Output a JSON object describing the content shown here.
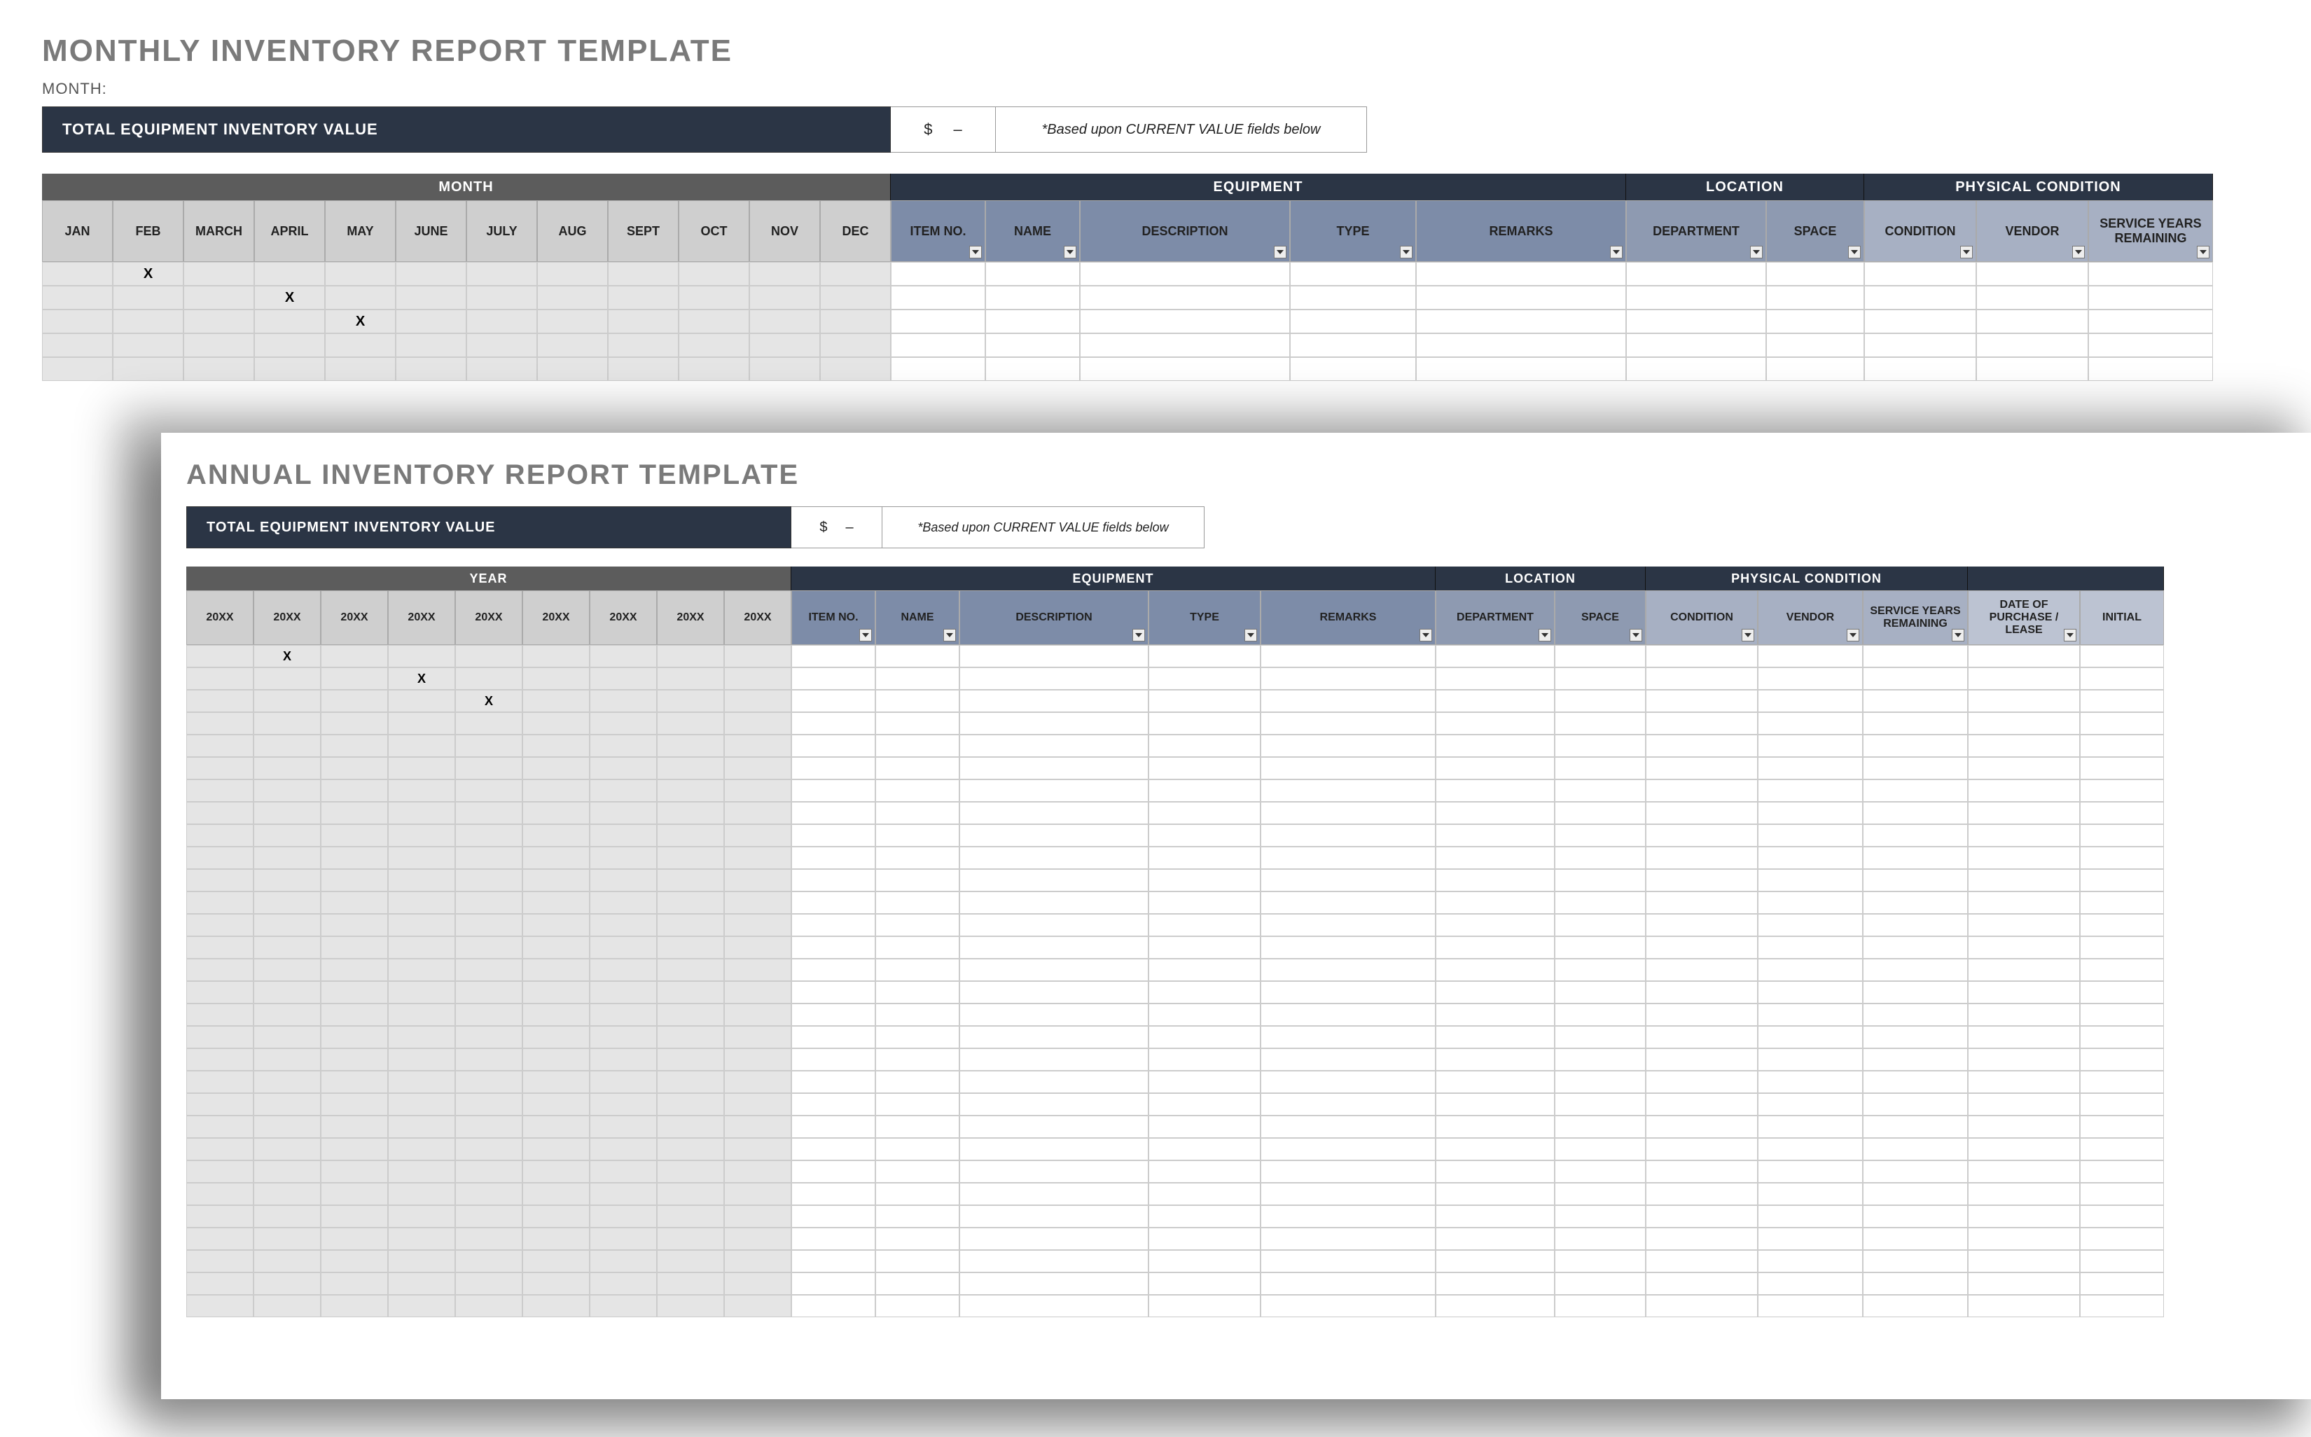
{
  "monthly": {
    "title": "MONTHLY INVENTORY REPORT TEMPLATE",
    "month_label": "MONTH:",
    "total_label": "TOTAL EQUIPMENT INVENTORY VALUE",
    "total_currency": "$",
    "total_amount": "–",
    "total_note": "*Based upon CURRENT VALUE fields below",
    "band_month": "MONTH",
    "band_equipment": "EQUIPMENT",
    "band_location": "LOCATION",
    "band_physical": "PHYSICAL CONDITION",
    "months": [
      "JAN",
      "FEB",
      "MARCH",
      "APRIL",
      "MAY",
      "JUNE",
      "JULY",
      "AUG",
      "SEPT",
      "OCT",
      "NOV",
      "DEC"
    ],
    "cols": {
      "item": "ITEM NO.",
      "name": "NAME",
      "desc": "DESCRIPTION",
      "type": "TYPE",
      "remarks": "REMARKS",
      "dept": "DEPARTMENT",
      "space": "SPACE",
      "cond": "CONDITION",
      "vendor": "VENDOR",
      "service": "SERVICE YEARS REMAINING"
    },
    "rows": [
      {
        "month_marks": [
          "",
          "X",
          "",
          "",
          "",
          "",
          "",
          "",
          "",
          "",
          "",
          ""
        ]
      },
      {
        "month_marks": [
          "",
          "",
          "",
          "X",
          "",
          "",
          "",
          "",
          "",
          "",
          "",
          ""
        ]
      },
      {
        "month_marks": [
          "",
          "",
          "",
          "",
          "X",
          "",
          "",
          "",
          "",
          "",
          "",
          ""
        ]
      },
      {
        "month_marks": [
          "",
          "",
          "",
          "",
          "",
          "",
          "",
          "",
          "",
          "",
          "",
          ""
        ]
      },
      {
        "month_marks": [
          "",
          "",
          "",
          "",
          "",
          "",
          "",
          "",
          "",
          "",
          "",
          ""
        ]
      }
    ]
  },
  "annual": {
    "title": "ANNUAL INVENTORY REPORT TEMPLATE",
    "total_label": "TOTAL EQUIPMENT INVENTORY VALUE",
    "total_currency": "$",
    "total_amount": "–",
    "total_note": "*Based upon CURRENT VALUE fields below",
    "band_year": "YEAR",
    "band_equipment": "EQUIPMENT",
    "band_location": "LOCATION",
    "band_physical": "PHYSICAL CONDITION",
    "years": [
      "20XX",
      "20XX",
      "20XX",
      "20XX",
      "20XX",
      "20XX",
      "20XX",
      "20XX",
      "20XX"
    ],
    "cols": {
      "item": "ITEM NO.",
      "name": "NAME",
      "desc": "DESCRIPTION",
      "type": "TYPE",
      "remarks": "REMARKS",
      "dept": "DEPARTMENT",
      "space": "SPACE",
      "cond": "CONDITION",
      "vendor": "VENDOR",
      "service": "SERVICE YEARS REMAINING",
      "date": "DATE OF PURCHASE / LEASE",
      "initial": "INITIAL"
    },
    "rows": [
      {
        "year_marks": [
          "",
          "X",
          "",
          "",
          "",
          "",
          "",
          "",
          ""
        ]
      },
      {
        "year_marks": [
          "",
          "",
          "",
          "X",
          "",
          "",
          "",
          "",
          ""
        ]
      },
      {
        "year_marks": [
          "",
          "",
          "",
          "",
          "X",
          "",
          "",
          "",
          ""
        ]
      },
      {
        "year_marks": [
          "",
          "",
          "",
          "",
          "",
          "",
          "",
          "",
          ""
        ]
      },
      {
        "year_marks": [
          "",
          "",
          "",
          "",
          "",
          "",
          "",
          "",
          ""
        ]
      },
      {
        "year_marks": [
          "",
          "",
          "",
          "",
          "",
          "",
          "",
          "",
          ""
        ]
      },
      {
        "year_marks": [
          "",
          "",
          "",
          "",
          "",
          "",
          "",
          "",
          ""
        ]
      },
      {
        "year_marks": [
          "",
          "",
          "",
          "",
          "",
          "",
          "",
          "",
          ""
        ]
      },
      {
        "year_marks": [
          "",
          "",
          "",
          "",
          "",
          "",
          "",
          "",
          ""
        ]
      },
      {
        "year_marks": [
          "",
          "",
          "",
          "",
          "",
          "",
          "",
          "",
          ""
        ]
      },
      {
        "year_marks": [
          "",
          "",
          "",
          "",
          "",
          "",
          "",
          "",
          ""
        ]
      },
      {
        "year_marks": [
          "",
          "",
          "",
          "",
          "",
          "",
          "",
          "",
          ""
        ]
      },
      {
        "year_marks": [
          "",
          "",
          "",
          "",
          "",
          "",
          "",
          "",
          ""
        ]
      },
      {
        "year_marks": [
          "",
          "",
          "",
          "",
          "",
          "",
          "",
          "",
          ""
        ]
      },
      {
        "year_marks": [
          "",
          "",
          "",
          "",
          "",
          "",
          "",
          "",
          ""
        ]
      },
      {
        "year_marks": [
          "",
          "",
          "",
          "",
          "",
          "",
          "",
          "",
          ""
        ]
      },
      {
        "year_marks": [
          "",
          "",
          "",
          "",
          "",
          "",
          "",
          "",
          ""
        ]
      },
      {
        "year_marks": [
          "",
          "",
          "",
          "",
          "",
          "",
          "",
          "",
          ""
        ]
      },
      {
        "year_marks": [
          "",
          "",
          "",
          "",
          "",
          "",
          "",
          "",
          ""
        ]
      },
      {
        "year_marks": [
          "",
          "",
          "",
          "",
          "",
          "",
          "",
          "",
          ""
        ]
      },
      {
        "year_marks": [
          "",
          "",
          "",
          "",
          "",
          "",
          "",
          "",
          ""
        ]
      },
      {
        "year_marks": [
          "",
          "",
          "",
          "",
          "",
          "",
          "",
          "",
          ""
        ]
      },
      {
        "year_marks": [
          "",
          "",
          "",
          "",
          "",
          "",
          "",
          "",
          ""
        ]
      },
      {
        "year_marks": [
          "",
          "",
          "",
          "",
          "",
          "",
          "",
          "",
          ""
        ]
      },
      {
        "year_marks": [
          "",
          "",
          "",
          "",
          "",
          "",
          "",
          "",
          ""
        ]
      },
      {
        "year_marks": [
          "",
          "",
          "",
          "",
          "",
          "",
          "",
          "",
          ""
        ]
      },
      {
        "year_marks": [
          "",
          "",
          "",
          "",
          "",
          "",
          "",
          "",
          ""
        ]
      },
      {
        "year_marks": [
          "",
          "",
          "",
          "",
          "",
          "",
          "",
          "",
          ""
        ]
      },
      {
        "year_marks": [
          "",
          "",
          "",
          "",
          "",
          "",
          "",
          "",
          ""
        ]
      },
      {
        "year_marks": [
          "",
          "",
          "",
          "",
          "",
          "",
          "",
          "",
          ""
        ]
      }
    ]
  }
}
